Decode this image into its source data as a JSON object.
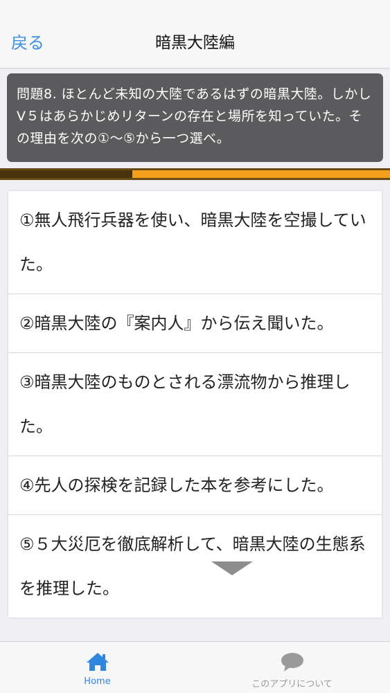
{
  "nav": {
    "back_label": "戻る",
    "title": "暗黒大陸編"
  },
  "question": {
    "text": "問題8. ほとんど未知の大陸であるはずの暗黒大陸。しかしV５はあらかじめリターンの存在と場所を知っていた。その理由を次の①〜⑤から一つ選べ。"
  },
  "progress": {
    "fraction": 0.34,
    "fill_color": "#f4a11c",
    "track_color": "#6a4a16"
  },
  "answers": [
    {
      "label": "①無人飛行兵器を使い、暗黒大陸を空撮していた。"
    },
    {
      "label": "②暗黒大陸の『案内人』から伝え聞いた。"
    },
    {
      "label": "③暗黒大陸のものとされる漂流物から推理した。"
    },
    {
      "label": "④先人の探検を記録した本を参考にした。"
    },
    {
      "label": "⑤５大災厄を徹底解析して、暗黒大陸の生態系を推理した。"
    }
  ],
  "tabbar": {
    "home_label": "Home",
    "home_icon": "home-icon",
    "about_label": "このアプリについて",
    "about_icon": "speech-bubble-icon",
    "active_color": "#2f86de",
    "inactive_color": "#9a9a9a"
  }
}
